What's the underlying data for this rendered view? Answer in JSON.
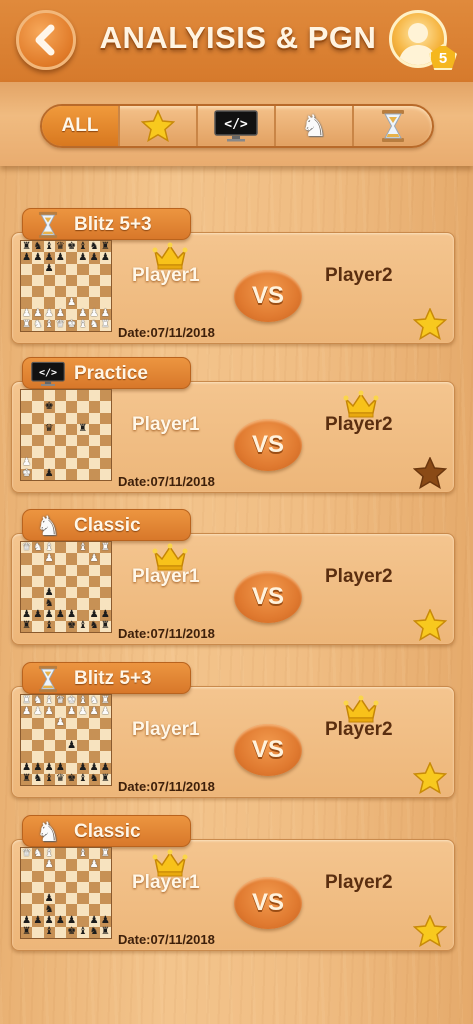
{
  "header": {
    "title": "ANALYISIS & PGN",
    "level": "5"
  },
  "filters": {
    "all_label": "ALL",
    "tabs": [
      "all",
      "star-icon",
      "code-monitor-icon",
      "knight-icon",
      "hourglass-icon"
    ],
    "active": "all"
  },
  "colors": {
    "header": "#d67a2c",
    "accent": "#e8893a",
    "text_light": "#fff6e6",
    "text_dark": "#5a2e10",
    "star_gold": "#f6c21b",
    "star_brown": "#8a4a16"
  },
  "games": [
    {
      "mode": "Blitz 5+3",
      "mode_icon": "hourglass-icon",
      "player1": "Player1",
      "player2": "Player2",
      "vs": "VS",
      "winner": "player1",
      "date": "Date:07/11/2018",
      "favorite": true,
      "board": [
        "rnbqkbnr",
        "pppp.ppp",
        "..p.....",
        "........",
        "........",
        "....P...",
        "PPPP.PPP",
        "RNBQKBNR"
      ]
    },
    {
      "mode": "Practice",
      "mode_icon": "code-monitor-icon",
      "player1": "Player1",
      "player2": "Player2",
      "vs": "VS",
      "winner": "player2",
      "date": "Date:07/11/2018",
      "favorite": false,
      "board": [
        "........",
        "..k.....",
        "........",
        "..q..r..",
        "........",
        "........",
        "P.......",
        "K.p....."
      ]
    },
    {
      "mode": "Classic",
      "mode_icon": "knight-icon",
      "player1": "Player1",
      "player2": "Player2",
      "vs": "VS",
      "winner": "player1",
      "date": "Date:07/11/2018",
      "favorite": true,
      "board": [
        "QNB..B.R",
        "..P...P.",
        "........",
        "........",
        "..p.....",
        "..n.....",
        "ppppp.pp",
        "r.b.kbnr"
      ]
    },
    {
      "mode": "Blitz 5+3",
      "mode_icon": "hourglass-icon",
      "player1": "Player1",
      "player2": "Player2",
      "vs": "VS",
      "winner": "player2",
      "date": "Date:07/11/2018",
      "favorite": true,
      "board": [
        "RNBQKBNR",
        "PPP.PPPP",
        "...P....",
        "........",
        "....p...",
        "........",
        "pppp.ppp",
        "rnbqkbnr"
      ]
    },
    {
      "mode": "Classic",
      "mode_icon": "knight-icon",
      "player1": "Player1",
      "player2": "Player2",
      "vs": "VS",
      "winner": "player1",
      "date": "Date:07/11/2018",
      "favorite": true,
      "board": [
        "QNB..B.R",
        "..P...P.",
        "........",
        "........",
        "..p.....",
        "..n.....",
        "ppppp.pp",
        "r.b.kbnr"
      ]
    }
  ]
}
